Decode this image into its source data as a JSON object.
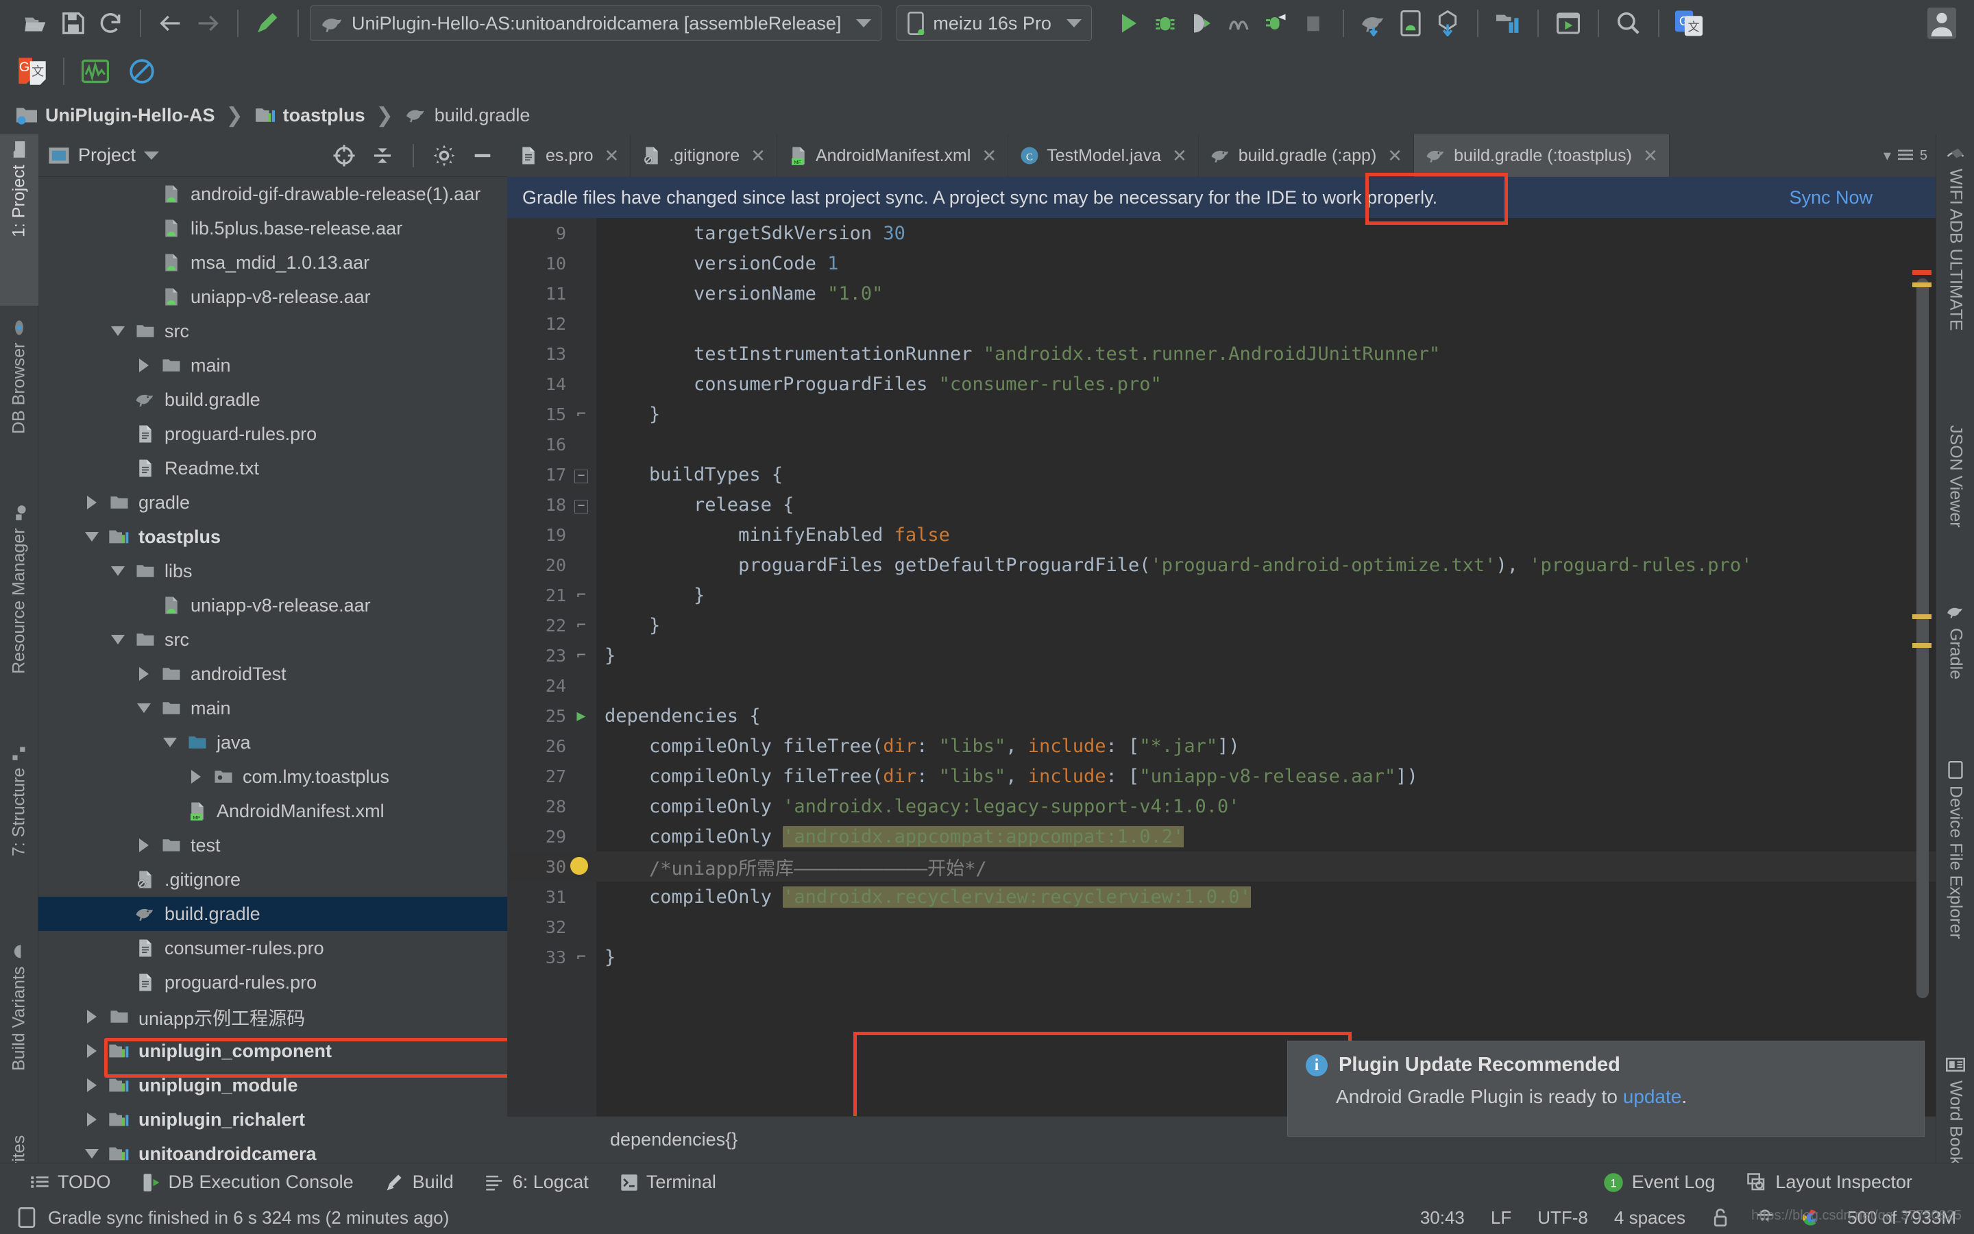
{
  "window": {
    "run_config": "UniPlugin-Hello-AS:unitoandroidcamera [assembleRelease]",
    "device": "meizu 16s Pro"
  },
  "breadcrumb": [
    {
      "label": "UniPlugin-Hello-AS",
      "icon": "project-folder-icon"
    },
    {
      "label": "toastplus",
      "icon": "module-icon"
    },
    {
      "label": "build.gradle",
      "icon": "gradle-icon"
    }
  ],
  "project_panel": {
    "title": "Project",
    "icons": [
      "locate-icon",
      "collapse-all-icon",
      "settings-gear-icon",
      "hide-icon"
    ],
    "tree": [
      {
        "depth": 4,
        "label": "android-gif-drawable-release(1).aar",
        "icon": "aar-icon",
        "twisty": "none"
      },
      {
        "depth": 4,
        "label": "lib.5plus.base-release.aar",
        "icon": "aar-icon",
        "twisty": "none"
      },
      {
        "depth": 4,
        "label": "msa_mdid_1.0.13.aar",
        "icon": "aar-icon",
        "twisty": "none"
      },
      {
        "depth": 4,
        "label": "uniapp-v8-release.aar",
        "icon": "aar-icon",
        "twisty": "none"
      },
      {
        "depth": 3,
        "label": "src",
        "icon": "folder-icon",
        "twisty": "down"
      },
      {
        "depth": 4,
        "label": "main",
        "icon": "folder-icon",
        "twisty": "right"
      },
      {
        "depth": 3,
        "label": "build.gradle",
        "icon": "gradle-icon",
        "twisty": "none"
      },
      {
        "depth": 3,
        "label": "proguard-rules.pro",
        "icon": "file-icon",
        "twisty": "none"
      },
      {
        "depth": 3,
        "label": "Readme.txt",
        "icon": "file-icon",
        "twisty": "none"
      },
      {
        "depth": 2,
        "label": "gradle",
        "icon": "folder-icon",
        "twisty": "right"
      },
      {
        "depth": 2,
        "label": "toastplus",
        "icon": "module-icon",
        "twisty": "down",
        "bold": true
      },
      {
        "depth": 3,
        "label": "libs",
        "icon": "folder-icon",
        "twisty": "down"
      },
      {
        "depth": 4,
        "label": "uniapp-v8-release.aar",
        "icon": "aar-icon",
        "twisty": "none"
      },
      {
        "depth": 3,
        "label": "src",
        "icon": "folder-icon",
        "twisty": "down"
      },
      {
        "depth": 4,
        "label": "androidTest",
        "icon": "folder-icon",
        "twisty": "right"
      },
      {
        "depth": 4,
        "label": "main",
        "icon": "folder-icon",
        "twisty": "down"
      },
      {
        "depth": 5,
        "label": "java",
        "icon": "java-folder-icon",
        "twisty": "down"
      },
      {
        "depth": 6,
        "label": "com.lmy.toastplus",
        "icon": "package-icon",
        "twisty": "right"
      },
      {
        "depth": 5,
        "label": "AndroidManifest.xml",
        "icon": "manifest-icon",
        "twisty": "none"
      },
      {
        "depth": 4,
        "label": "test",
        "icon": "folder-icon",
        "twisty": "right"
      },
      {
        "depth": 3,
        "label": ".gitignore",
        "icon": "gitignore-icon",
        "twisty": "none"
      },
      {
        "depth": 3,
        "label": "build.gradle",
        "icon": "gradle-icon",
        "twisty": "none",
        "selected": true
      },
      {
        "depth": 3,
        "label": "consumer-rules.pro",
        "icon": "file-icon",
        "twisty": "none"
      },
      {
        "depth": 3,
        "label": "proguard-rules.pro",
        "icon": "file-icon",
        "twisty": "none"
      },
      {
        "depth": 2,
        "label": "uniapp示例工程源码",
        "icon": "folder-icon",
        "twisty": "right"
      },
      {
        "depth": 2,
        "label": "uniplugin_component",
        "icon": "module-icon",
        "twisty": "right",
        "bold": true
      },
      {
        "depth": 2,
        "label": "uniplugin_module",
        "icon": "module-icon",
        "twisty": "right",
        "bold": true
      },
      {
        "depth": 2,
        "label": "uniplugin_richalert",
        "icon": "module-icon",
        "twisty": "right",
        "bold": true
      },
      {
        "depth": 2,
        "label": "unitoandroidcamera",
        "icon": "module-icon",
        "twisty": "down",
        "bold": true
      }
    ]
  },
  "left_tool_tabs": [
    {
      "label": "1: Project",
      "icon": "project-icon",
      "active": true
    },
    {
      "label": "DB Browser",
      "icon": "db-browser-icon",
      "active": false
    },
    {
      "label": "Resource Manager",
      "icon": "resource-icon",
      "active": false
    },
    {
      "label": "7: Structure",
      "icon": "structure-icon",
      "active": false
    },
    {
      "label": "Build Variants",
      "icon": "android-icon",
      "active": false
    },
    {
      "label": "rites",
      "icon": "favorites-icon",
      "active": false
    }
  ],
  "right_tool_tabs": [
    {
      "label": "WIFI ADB ULTIMATE",
      "icon": "wifi-adb-icon"
    },
    {
      "label": "JSON Viewer",
      "icon": "json-icon"
    },
    {
      "label": "Gradle",
      "icon": "gradle-icon"
    },
    {
      "label": "Device File Explorer",
      "icon": "device-icon"
    },
    {
      "label": "Word Book",
      "icon": "book-icon"
    }
  ],
  "editor_tabs": [
    {
      "label": "es.pro",
      "icon": "file-icon",
      "active": false
    },
    {
      "label": ".gitignore",
      "icon": "gitignore-icon",
      "active": false
    },
    {
      "label": "AndroidManifest.xml",
      "icon": "manifest-icon",
      "active": false
    },
    {
      "label": "TestModel.java",
      "icon": "class-icon",
      "active": false
    },
    {
      "label": "build.gradle (:app)",
      "icon": "gradle-icon",
      "active": false
    },
    {
      "label": "build.gradle (:toastplus)",
      "icon": "gradle-icon",
      "active": true
    }
  ],
  "tabs_overflow_count": "5",
  "notification": {
    "message": "Gradle files have changed since last project sync. A project sync may be necessary for the IDE to work properly.",
    "action": "Sync Now"
  },
  "code": {
    "first_line": 9,
    "lines": [
      {
        "n": 9,
        "fold": "",
        "tokens": [
          [
            "p",
            "        targetSdkVersion "
          ],
          [
            "n",
            "30"
          ]
        ]
      },
      {
        "n": 10,
        "fold": "",
        "tokens": [
          [
            "p",
            "        versionCode "
          ],
          [
            "n",
            "1"
          ]
        ]
      },
      {
        "n": 11,
        "fold": "",
        "tokens": [
          [
            "p",
            "        versionName "
          ],
          [
            "s",
            "\"1.0\""
          ]
        ]
      },
      {
        "n": 12,
        "fold": "",
        "tokens": [
          [
            "p",
            ""
          ]
        ]
      },
      {
        "n": 13,
        "fold": "",
        "tokens": [
          [
            "p",
            "        testInstrumentationRunner "
          ],
          [
            "s",
            "\"androidx.test.runner.AndroidJUnitRunner\""
          ]
        ]
      },
      {
        "n": 14,
        "fold": "",
        "tokens": [
          [
            "p",
            "        consumerProguardFiles "
          ],
          [
            "s",
            "\"consumer-rules.pro\""
          ]
        ]
      },
      {
        "n": 15,
        "fold": "end",
        "tokens": [
          [
            "p",
            "    }"
          ]
        ]
      },
      {
        "n": 16,
        "fold": "",
        "tokens": [
          [
            "p",
            ""
          ]
        ]
      },
      {
        "n": 17,
        "fold": "start",
        "tokens": [
          [
            "p",
            "    buildTypes {"
          ]
        ]
      },
      {
        "n": 18,
        "fold": "start",
        "tokens": [
          [
            "p",
            "        release {"
          ]
        ]
      },
      {
        "n": 19,
        "fold": "",
        "tokens": [
          [
            "p",
            "            minifyEnabled "
          ],
          [
            "k",
            "false"
          ]
        ]
      },
      {
        "n": 20,
        "fold": "",
        "tokens": [
          [
            "p",
            "            proguardFiles getDefaultProguardFile("
          ],
          [
            "s",
            "'proguard-android-optimize.txt'"
          ],
          [
            "p",
            "), "
          ],
          [
            "s",
            "'proguard-rules.pro'"
          ]
        ]
      },
      {
        "n": 21,
        "fold": "end",
        "tokens": [
          [
            "p",
            "        }"
          ]
        ]
      },
      {
        "n": 22,
        "fold": "end",
        "tokens": [
          [
            "p",
            "    }"
          ]
        ]
      },
      {
        "n": 23,
        "fold": "end",
        "tokens": [
          [
            "p",
            "}"
          ]
        ]
      },
      {
        "n": 24,
        "fold": "",
        "tokens": [
          [
            "p",
            ""
          ]
        ]
      },
      {
        "n": 25,
        "fold": "start",
        "run": true,
        "tokens": [
          [
            "p",
            "dependencies {"
          ]
        ]
      },
      {
        "n": 26,
        "fold": "",
        "tokens": [
          [
            "p",
            "    compileOnly fileTree("
          ],
          [
            "k",
            "dir"
          ],
          [
            "p",
            ": "
          ],
          [
            "s",
            "\"libs\""
          ],
          [
            "p",
            ", "
          ],
          [
            "k",
            "include"
          ],
          [
            "p",
            ": ["
          ],
          [
            "s",
            "\"*.jar\""
          ],
          [
            "p",
            "])"
          ]
        ]
      },
      {
        "n": 27,
        "fold": "",
        "tokens": [
          [
            "p",
            "    compileOnly fileTree("
          ],
          [
            "k",
            "dir"
          ],
          [
            "p",
            ": "
          ],
          [
            "s",
            "\"libs\""
          ],
          [
            "p",
            ", "
          ],
          [
            "k",
            "include"
          ],
          [
            "p",
            ": ["
          ],
          [
            "s",
            "\"uniapp-v8-release.aar\""
          ],
          [
            "p",
            "])"
          ]
        ]
      },
      {
        "n": 28,
        "fold": "",
        "tokens": [
          [
            "p",
            "    compileOnly "
          ],
          [
            "s",
            "'androidx.legacy:legacy-support-v4:1.0.0'"
          ]
        ]
      },
      {
        "n": 29,
        "fold": "",
        "tokens": [
          [
            "p",
            "    compileOnly "
          ],
          [
            "shi",
            "'androidx.appcompat:appcompat:1.0.2'"
          ]
        ]
      },
      {
        "n": 30,
        "fold": "",
        "bulb": true,
        "current": true,
        "tokens": [
          [
            "cm",
            "    /*uniapp所需库————————————开始*/"
          ]
        ]
      },
      {
        "n": 31,
        "fold": "",
        "tokens": [
          [
            "p",
            "    compileOnly "
          ],
          [
            "shi",
            "'androidx.recyclerview:recyclerview:1.0.0'"
          ]
        ]
      },
      {
        "n": 32,
        "fold": "",
        "tokens": [
          [
            "p",
            ""
          ]
        ]
      },
      {
        "n": 33,
        "fold": "end",
        "tokens": [
          [
            "p",
            "}"
          ]
        ]
      }
    ]
  },
  "editor_breadcrumb": "dependencies{}",
  "plugin_notification": {
    "title": "Plugin Update Recommended",
    "body_prefix": "Android Gradle Plugin is ready to ",
    "body_link": "update",
    "body_suffix": "."
  },
  "bottom_tool_tabs": [
    {
      "label": "TODO",
      "icon": "todo-icon"
    },
    {
      "label": "DB Execution Console",
      "icon": "db-console-icon"
    },
    {
      "label": "Build",
      "icon": "build-icon"
    },
    {
      "label": "6: Logcat",
      "icon": "logcat-icon"
    },
    {
      "label": "Terminal",
      "icon": "terminal-icon"
    }
  ],
  "bottom_right_tabs": [
    {
      "label": "Event Log",
      "icon": "event-log-icon",
      "badge": "1"
    },
    {
      "label": "Layout Inspector",
      "icon": "layout-inspector-icon"
    }
  ],
  "status_bar": {
    "message": "Gradle sync finished in 6 s 324 ms (2 minutes ago)",
    "caret": "30:43",
    "line_sep": "LF",
    "encoding": "UTF-8",
    "indent": "4 spaces",
    "memory": "500 of 7933M"
  },
  "watermark": "https://blog.csdn.net/qq_37750825",
  "colors": {
    "accent_red": "#e8412a",
    "link_blue": "#5a9de8",
    "notif_bg": "#2b3a55",
    "editor_bg": "#2b2b2b",
    "chrome_bg": "#3c3f41",
    "string_green": "#6a8759",
    "keyword_orange": "#cc7832",
    "number_blue": "#6897bb"
  }
}
